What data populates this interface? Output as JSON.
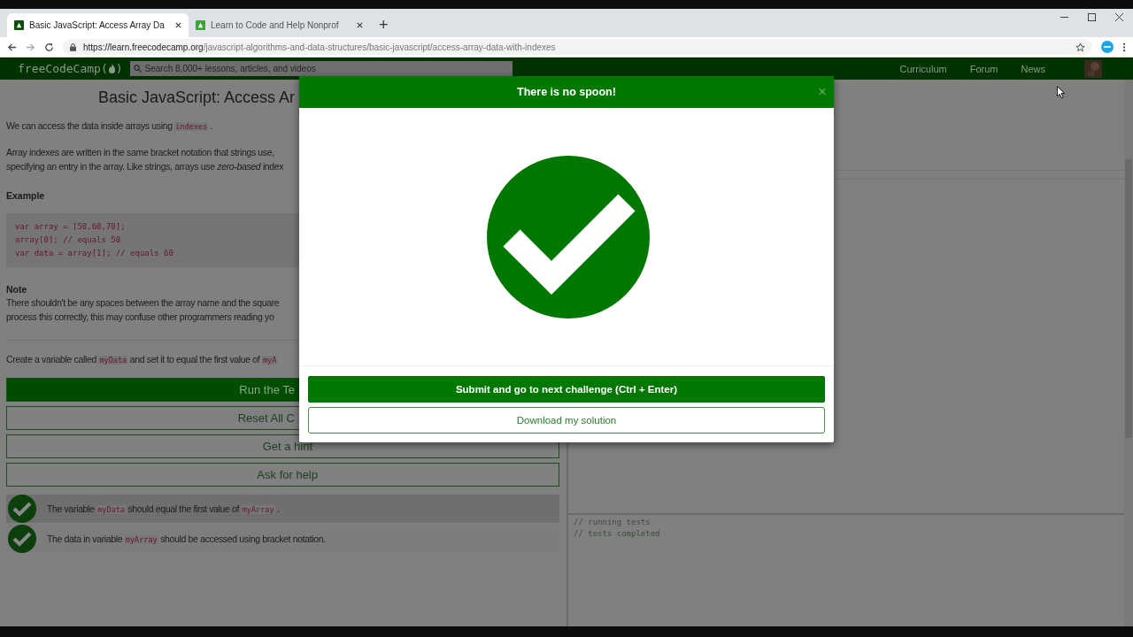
{
  "browser": {
    "tabs": [
      {
        "title": "Basic JavaScript: Access Array Da",
        "selected": true
      },
      {
        "title": "Learn to Code and Help Nonprof",
        "selected": false
      }
    ],
    "new_tab": "+",
    "url_host": "https://learn.freecodecamp.org",
    "url_path": "/javascript-algorithms-and-data-structures/basic-javascript/access-array-data-with-indexes"
  },
  "nav": {
    "logo_before": "freeCodeCamp(",
    "logo_after": ")",
    "search": {
      "placeholder": "Search 8,000+ lessons, articles, and videos"
    },
    "links": [
      "Curriculum",
      "Forum",
      "News"
    ]
  },
  "lesson": {
    "title": "Basic JavaScript: Access Ar",
    "intro": [
      {
        "kind": "text",
        "text": "We can access the data inside arrays using "
      },
      {
        "kind": "code",
        "text": "indexes"
      },
      {
        "kind": "text",
        "text": " ."
      }
    ],
    "paragraph": [
      "Array indexes are written in the same bracket notation that strings use,",
      "specifying an entry in the array. Like strings, arrays use *zero-based* index"
    ],
    "example_heading": "Example",
    "code": [
      "var array = [50,60,70];",
      "array[0]; // equals 50",
      "var data = array[1]; // equals 60"
    ],
    "note_heading": "Note",
    "note": [
      "There shouldn't be any spaces between the array name and the square",
      "process this correctly, this may confuse other programmers reading yo"
    ],
    "task": [
      {
        "kind": "text",
        "text": "Create a variable called "
      },
      {
        "kind": "code",
        "text": "myData"
      },
      {
        "kind": "text",
        "text": " and set it to equal the first value of "
      },
      {
        "kind": "code",
        "text": "myA"
      }
    ],
    "buttons": [
      {
        "label": "Run the Te",
        "kind": "primary"
      },
      {
        "label": "Reset All C",
        "kind": "outline"
      },
      {
        "label": "Get a hint",
        "kind": "outline"
      },
      {
        "label": "Ask for help",
        "kind": "outline"
      }
    ],
    "tests": [
      {
        "passed": true,
        "highlighted": true,
        "parts": [
          {
            "kind": "text",
            "text": "The variable "
          },
          {
            "kind": "code",
            "text": "myData"
          },
          {
            "kind": "text",
            "text": " should equal the first value of "
          },
          {
            "kind": "code",
            "text": "myArray"
          },
          {
            "kind": "text",
            "text": " ."
          }
        ]
      },
      {
        "passed": true,
        "highlighted": false,
        "parts": [
          {
            "kind": "text",
            "text": "The data in variable "
          },
          {
            "kind": "code",
            "text": "myArray"
          },
          {
            "kind": "text",
            "text": " should be accessed using bracket notation."
          }
        ]
      }
    ]
  },
  "console": [
    "// running tests",
    "// tests completed"
  ],
  "modal": {
    "title": "There is no spoon!",
    "close": "×",
    "submit": "Submit and go to next challenge (Ctrl + Enter)",
    "download": "Download my solution"
  }
}
